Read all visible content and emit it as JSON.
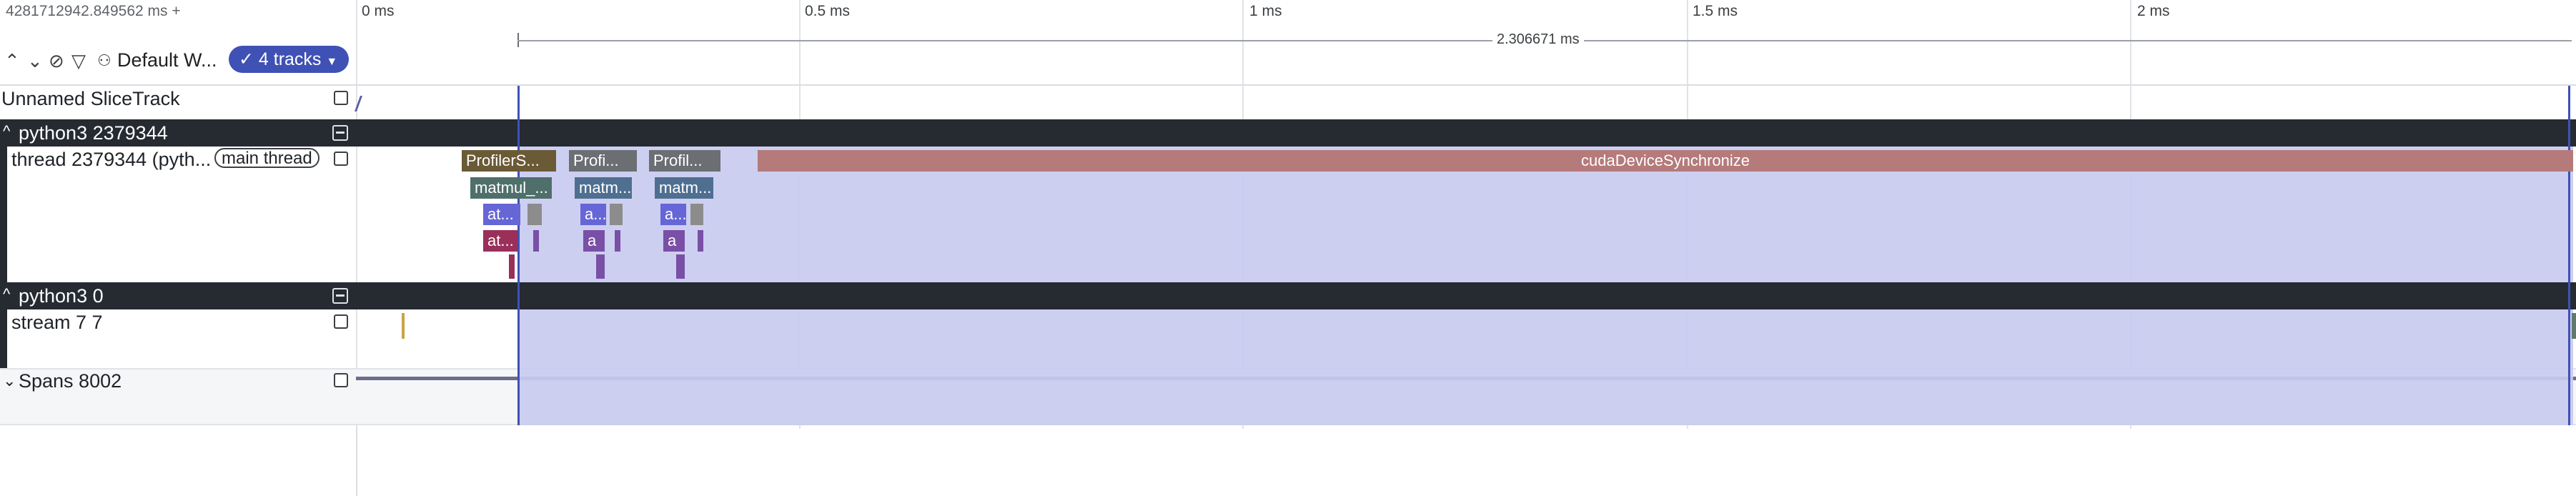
{
  "header": {
    "timestamp": "4281712942.849562 ms +",
    "workspace": "Default W...",
    "tracks_button": "4 tracks"
  },
  "ruler": {
    "ticks": [
      "0 ms",
      "0.5 ms",
      "1 ms",
      "1.5 ms",
      "2 ms"
    ],
    "selection_duration": "2.306671 ms"
  },
  "tracks": {
    "unnamed": "Unnamed SliceTrack",
    "process1": "python3 2379344",
    "thread": "thread 2379344 (pyth...",
    "thread_chip": "main thread",
    "process2": "python3 0",
    "stream": "stream 7 7",
    "spans": "Spans 8002"
  },
  "slices": {
    "profiler1": "ProfilerS...",
    "profiler2": "Profi...",
    "profiler3": "Profil...",
    "matmul1": "matmul_...",
    "matmul2": "matm...",
    "matmul3": "matm...",
    "aten1": "at...",
    "aten2": "a...",
    "aten3": "a...",
    "aten4": "at...",
    "aten5": "a",
    "aten6": "a",
    "cuda_sync": "cudaDeviceSynchronize"
  },
  "colors": {
    "selection": "#c9cbf0",
    "selection_line": "#3f51b5",
    "group_header": "#262a31",
    "cuda_sync": "#b57a7a",
    "profiler": "#6b6e73",
    "matmul": "#4f6f91"
  }
}
